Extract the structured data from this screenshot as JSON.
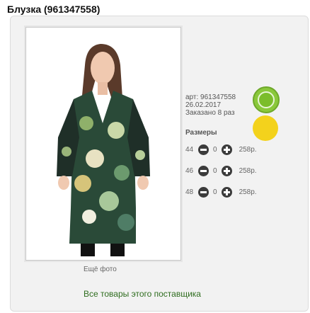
{
  "product": {
    "title": "Блузка (961347558)",
    "article": "арт: 961347558",
    "date": "26.02.2017",
    "ordered": "Заказано 8 раз"
  },
  "sizes": {
    "heading": "Размеры",
    "rows": [
      {
        "size": "44",
        "qty": "0",
        "price": "258р."
      },
      {
        "size": "46",
        "qty": "0",
        "price": "258р."
      },
      {
        "size": "48",
        "qty": "0",
        "price": "258р."
      }
    ]
  },
  "links": {
    "more_photo": "Ещё фото",
    "supplier": "Все товары этого поставщика"
  },
  "icons": {
    "eco_badge": "leaf-badge-icon",
    "sun_badge": "sun-badge-icon",
    "decrease": "minus-circle-icon",
    "increase": "plus-circle-icon"
  },
  "colors": {
    "supplier_link": "#2f6d1f",
    "eco_badge": "#8ac83b",
    "sun_badge": "#f3d21c"
  }
}
